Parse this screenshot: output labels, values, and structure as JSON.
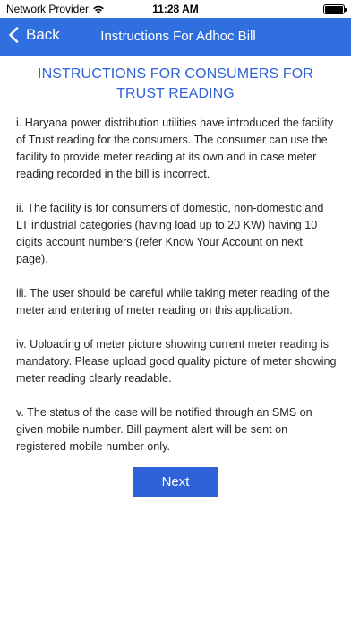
{
  "status_bar": {
    "carrier": "Network Provider",
    "time": "11:28 AM",
    "icons": [
      "wifi-icon",
      "battery-icon"
    ]
  },
  "nav": {
    "back_label": "Back",
    "title": "Instructions For Adhoc Bill",
    "back_icon": "chevron-left-icon",
    "bar_color": "#2f6fe0"
  },
  "main": {
    "heading": "INSTRUCTIONS FOR CONSUMERS FOR TRUST READING",
    "heading_color": "#2f62d6",
    "paragraphs": [
      "i. Haryana power distribution utilities have introduced the facility of Trust reading for the consumers. The consumer can use the facility to provide meter reading at its own and in case meter reading recorded in the bill is incorrect.",
      "ii. The facility is for consumers of domestic, non-domestic and LT industrial categories (having load up to 20 KW) having 10 digits account numbers (refer Know Your Account on next page).",
      "iii. The user should be careful while taking meter reading of the meter and entering of meter reading on this application.",
      "iv. Uploading of meter picture showing current meter reading is mandatory. Please upload good quality picture of meter showing meter reading clearly readable.",
      "v. The status of the case will be notified through an SMS on given mobile number. Bill payment alert will be sent on registered mobile number only."
    ],
    "next_label": "Next"
  }
}
